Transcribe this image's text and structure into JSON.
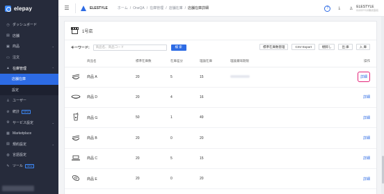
{
  "app": {
    "logo_text": "elepay"
  },
  "sidebar": {
    "items": [
      {
        "label": "ダッシュボード",
        "icon": "clock-icon",
        "chevron": ""
      },
      {
        "label": "店舗",
        "icon": "store-icon",
        "chevron": ""
      },
      {
        "label": "商品",
        "icon": "box-icon",
        "chevron": "⌄"
      },
      {
        "label": "注文",
        "icon": "order-icon",
        "chevron": ""
      },
      {
        "label": "在庫管理",
        "icon": "stock-icon",
        "chevron": "⌃"
      },
      {
        "label": "店舗在庫",
        "icon": "",
        "chevron": ""
      },
      {
        "label": "設定",
        "icon": "",
        "chevron": ""
      },
      {
        "label": "ユーザー",
        "icon": "user-icon",
        "chevron": ""
      },
      {
        "label": "統計",
        "icon": "chart-icon",
        "chevron": "",
        "badge": "NEW"
      },
      {
        "label": "サービス設定",
        "icon": "settings-icon",
        "chevron": "⌄"
      },
      {
        "label": "Marketplace",
        "icon": "grid-icon",
        "chevron": ""
      },
      {
        "label": "規約設定",
        "icon": "document-icon",
        "chevron": "⌄"
      },
      {
        "label": "言語設定",
        "icon": "globe-icon",
        "chevron": ""
      },
      {
        "label": "ツール",
        "icon": "tool-icon",
        "chevron": "",
        "badge": "NEW"
      }
    ]
  },
  "header": {
    "store_name": "ELESTYLE",
    "breadcrumb": [
      "ホーム",
      "OneQA",
      "在庫管理",
      "店舗在庫",
      "店舗在庫詳細"
    ],
    "user_name": "ELESTYLE",
    "user_sub": "ELESTYLE株式会社"
  },
  "main": {
    "store_title": "1号店",
    "keyword_label": "キーワード:",
    "search_placeholder": "商品名、商品コード",
    "search_button": "検 索",
    "actions": [
      "標準在庫数管理",
      "CSV Export",
      "棚卸し",
      "出 庫",
      "入 庫"
    ],
    "columns": [
      "",
      "商品名",
      "標準在庫数",
      "在庫差分",
      "理論在庫",
      "理論賞味期限",
      "操作"
    ],
    "rows": [
      {
        "name": "商品 A",
        "std": "20",
        "diff": "5",
        "theory": "15",
        "op": "詳細",
        "icon": "noodle-icon",
        "highlight": true
      },
      {
        "name": "商品 D",
        "std": "20",
        "diff": "4",
        "theory": "16",
        "op": "詳細",
        "icon": "bowl-icon",
        "highlight": false
      },
      {
        "name": "商品 G",
        "std": "50",
        "diff": "1",
        "theory": "49",
        "op": "詳細",
        "icon": "drink-icon",
        "highlight": false
      },
      {
        "name": "商品 B",
        "std": "20",
        "diff": "0",
        "theory": "20",
        "op": "詳細",
        "icon": "noodle-icon",
        "highlight": false
      },
      {
        "name": "商品 C",
        "std": "20",
        "diff": "5",
        "theory": "15",
        "op": "詳細",
        "icon": "plate-icon",
        "highlight": false
      },
      {
        "name": "商品 E",
        "std": "20",
        "diff": "0",
        "theory": "20",
        "op": "詳細",
        "icon": "dish-icon",
        "highlight": false
      }
    ]
  },
  "colors": {
    "accent": "#2d6be4",
    "sidebar": "#262b3b",
    "highlight": "#e32178"
  }
}
